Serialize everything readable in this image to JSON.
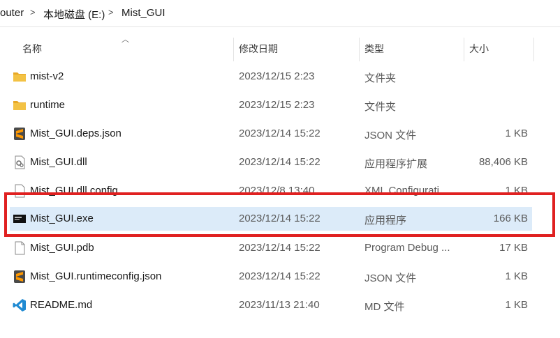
{
  "breadcrumb": {
    "items": [
      "outer",
      "本地磁盘 (E:)",
      "Mist_GUI"
    ],
    "separator": ">"
  },
  "columns": {
    "name": "名称",
    "modified": "修改日期",
    "type": "类型",
    "size": "大小"
  },
  "files": [
    {
      "name": "mist-v2",
      "modified": "2023/12/15 2:23",
      "type": "文件夹",
      "size": "",
      "icon": "folder-icon"
    },
    {
      "name": "runtime",
      "modified": "2023/12/15 2:23",
      "type": "文件夹",
      "size": "",
      "icon": "folder-icon"
    },
    {
      "name": "Mist_GUI.deps.json",
      "modified": "2023/12/14 15:22",
      "type": "JSON 文件",
      "size": "1 KB",
      "icon": "sublime-file-icon"
    },
    {
      "name": "Mist_GUI.dll",
      "modified": "2023/12/14 15:22",
      "type": "应用程序扩展",
      "size": "88,406 KB",
      "icon": "dll-file-icon"
    },
    {
      "name": "Mist_GUI.dll.config",
      "modified": "2023/12/8 13:40",
      "type": "XML Configurati...",
      "size": "1 KB",
      "icon": "config-file-icon"
    },
    {
      "name": "Mist_GUI.exe",
      "modified": "2023/12/14 15:22",
      "type": "应用程序",
      "size": "166 KB",
      "icon": "exe-app-icon"
    },
    {
      "name": "Mist_GUI.pdb",
      "modified": "2023/12/14 15:22",
      "type": "Program Debug ...",
      "size": "17 KB",
      "icon": "blank-file-icon"
    },
    {
      "name": "Mist_GUI.runtimeconfig.json",
      "modified": "2023/12/14 15:22",
      "type": "JSON 文件",
      "size": "1 KB",
      "icon": "sublime-file-icon"
    },
    {
      "name": "README.md",
      "modified": "2023/11/13 21:40",
      "type": "MD 文件",
      "size": "1 KB",
      "icon": "vscode-file-icon"
    }
  ],
  "colors": {
    "selection": "#dcebf9",
    "highlight_box": "#e02020",
    "folder": "#f3c244"
  }
}
